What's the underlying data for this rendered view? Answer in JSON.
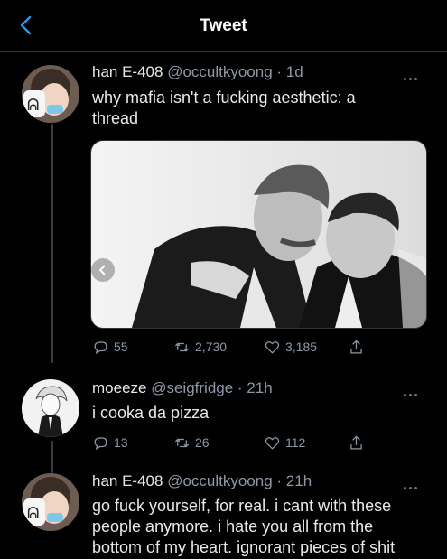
{
  "header": {
    "title": "Tweet"
  },
  "tweets": [
    {
      "name": "han E-408",
      "meta": "@occultkyoong · 1d",
      "text_lines": [
        "why mafia isn't a fucking aesthetic: a",
        "thread"
      ],
      "replies": "55",
      "retweets": "2,730",
      "likes": "3,185"
    },
    {
      "name": "moeeze",
      "meta": "@seigfridge · 21h",
      "text_lines": [
        "i cooka da pizza"
      ],
      "replies": "13",
      "retweets": "26",
      "likes": "112"
    },
    {
      "name": "han E-408",
      "meta": "@occultkyoong · 21h",
      "text_lines": [
        "go fuck yourself, for real. i cant with these",
        "people anymore. i hate you all from the",
        "bottom of my heart. ignorant pieces of shit"
      ]
    }
  ],
  "colors": {
    "accent": "#1d9bf0",
    "muted": "#8b98a5",
    "background": "#000000"
  },
  "icons": [
    "back-chevron-icon",
    "reply-icon",
    "retweet-icon",
    "like-icon",
    "share-icon",
    "more-icon"
  ]
}
